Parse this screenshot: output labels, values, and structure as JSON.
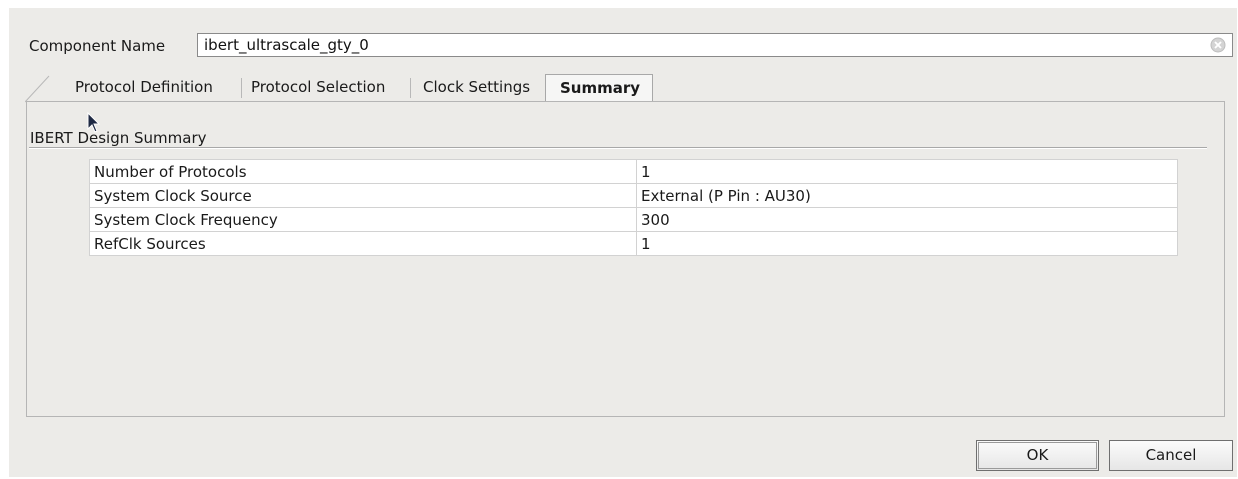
{
  "component": {
    "label": "Component Name",
    "value": "ibert_ultrascale_gty_0"
  },
  "tabs": [
    {
      "label": "Protocol Definition",
      "active": false
    },
    {
      "label": "Protocol Selection",
      "active": false
    },
    {
      "label": "Clock Settings",
      "active": false
    },
    {
      "label": "Summary",
      "active": true
    }
  ],
  "summary": {
    "title": "IBERT Design Summary",
    "rows": [
      {
        "name": "Number of Protocols",
        "value": "1"
      },
      {
        "name": "System Clock Source",
        "value": "External (P Pin : AU30)"
      },
      {
        "name": "System Clock Frequency",
        "value": "300"
      },
      {
        "name": "RefClk Sources",
        "value": "1"
      }
    ]
  },
  "buttons": {
    "ok": "OK",
    "cancel": "Cancel"
  },
  "icons": {
    "clear": "clear-icon",
    "cursor": "mouse-cursor-icon"
  }
}
